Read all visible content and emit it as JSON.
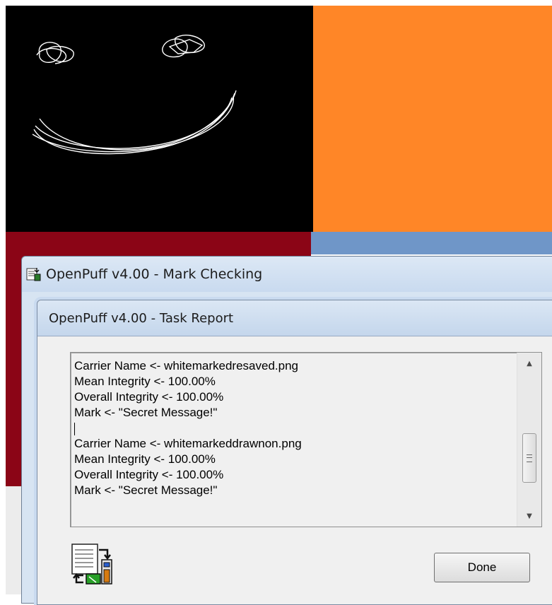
{
  "outer_window": {
    "title": "OpenPuff v4.00 - Mark Checking",
    "icon": "openpuff-app-icon"
  },
  "inner_window": {
    "title": "OpenPuff v4.00 - Task Report"
  },
  "report": {
    "lines": [
      "Carrier Name <- whitemarkedresaved.png",
      "Mean Integrity <- 100.00%",
      "Overall Integrity <- 100.00%",
      "Mark <- \"Secret Message!\"",
      "",
      "Carrier Name <- whitemarkeddrawnon.png",
      "Mean Integrity <- 100.00%",
      "Overall Integrity <- 100.00%",
      "Mark <- \"Secret Message!\""
    ]
  },
  "scrollbar": {
    "up_icon": "scroll-up-arrow-icon",
    "down_icon": "scroll-down-arrow-icon"
  },
  "footer": {
    "report_icon": "task-report-icon",
    "done_label": "Done"
  },
  "colors": {
    "background_black": "#000000",
    "background_orange": "#ff8627",
    "background_red": "#8b0516",
    "background_blue": "#6f96c8",
    "titlebar": "#c9daef"
  }
}
